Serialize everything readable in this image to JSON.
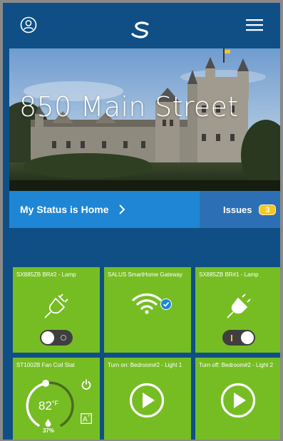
{
  "header": {
    "icons": {
      "user": "user-circle-icon",
      "logo": "salus-logo",
      "menu": "hamburger-menu-icon"
    }
  },
  "hero": {
    "address": "850 Main Street"
  },
  "status": {
    "label": "My Status is Home",
    "chevron": "chevron-right-icon"
  },
  "issues": {
    "label": "Issues",
    "count": "3"
  },
  "tiles": [
    {
      "title": "SX885ZB BR#2 - Lamp",
      "icon": "plug-outline-icon",
      "toggle": "off"
    },
    {
      "title": "SALUS SmartHome Gateway",
      "icon": "wifi-icon",
      "badge": "check-icon"
    },
    {
      "title": "SX885ZB BR#1 - Lamp",
      "icon": "plug-filled-icon",
      "toggle": "on"
    },
    {
      "title": "ST1002B Fan Coil Stat",
      "temperature": "82",
      "unit": "°F",
      "humidity": "37%"
    },
    {
      "title": "Turn on: Bedroom#2 - Light 1",
      "icon": "play-icon"
    },
    {
      "title": "Turn off: Bedroom#2 - Light 2",
      "icon": "play-icon"
    }
  ],
  "colors": {
    "background": "#0f4f86",
    "status_bar": "#1e86d4",
    "issues_bar": "#2c6fb5",
    "tile": "#76bd24",
    "badge": "#f6c626"
  }
}
